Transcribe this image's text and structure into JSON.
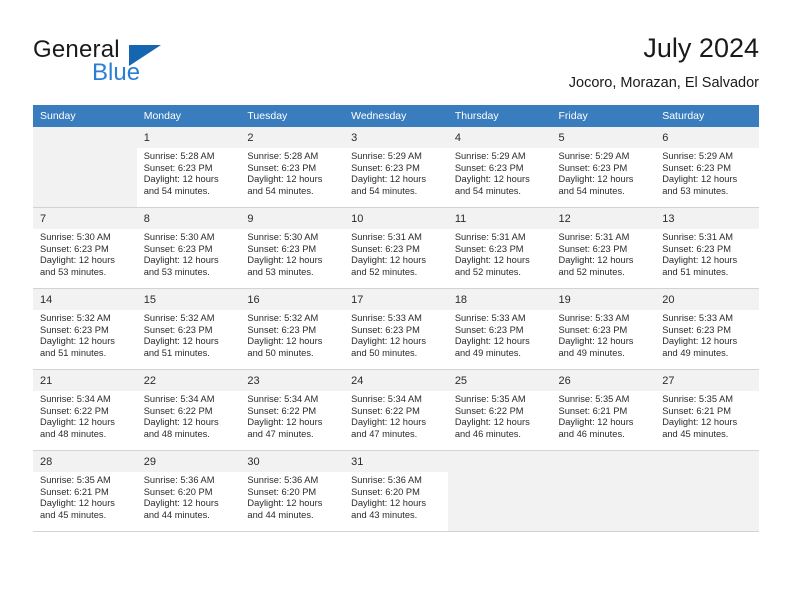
{
  "brand": {
    "word1": "General",
    "word2": "Blue",
    "triangle_icon": "triangle-icon",
    "accent_dark": "#1565b0",
    "accent_light": "#2a7fd4"
  },
  "header": {
    "title": "July 2024",
    "subtitle": "Jocoro, Morazan, El Salvador"
  },
  "calendar": {
    "header_bg": "#3a7dbf",
    "daynum_bg": "#f2f2f2",
    "weekdays": [
      "Sunday",
      "Monday",
      "Tuesday",
      "Wednesday",
      "Thursday",
      "Friday",
      "Saturday"
    ],
    "weeks": [
      [
        {
          "day": "",
          "sunrise": "",
          "sunset": "",
          "daylight1": "",
          "daylight2": "",
          "empty": true
        },
        {
          "day": "1",
          "sunrise": "Sunrise: 5:28 AM",
          "sunset": "Sunset: 6:23 PM",
          "daylight1": "Daylight: 12 hours",
          "daylight2": "and 54 minutes.",
          "empty": false
        },
        {
          "day": "2",
          "sunrise": "Sunrise: 5:28 AM",
          "sunset": "Sunset: 6:23 PM",
          "daylight1": "Daylight: 12 hours",
          "daylight2": "and 54 minutes.",
          "empty": false
        },
        {
          "day": "3",
          "sunrise": "Sunrise: 5:29 AM",
          "sunset": "Sunset: 6:23 PM",
          "daylight1": "Daylight: 12 hours",
          "daylight2": "and 54 minutes.",
          "empty": false
        },
        {
          "day": "4",
          "sunrise": "Sunrise: 5:29 AM",
          "sunset": "Sunset: 6:23 PM",
          "daylight1": "Daylight: 12 hours",
          "daylight2": "and 54 minutes.",
          "empty": false
        },
        {
          "day": "5",
          "sunrise": "Sunrise: 5:29 AM",
          "sunset": "Sunset: 6:23 PM",
          "daylight1": "Daylight: 12 hours",
          "daylight2": "and 54 minutes.",
          "empty": false
        },
        {
          "day": "6",
          "sunrise": "Sunrise: 5:29 AM",
          "sunset": "Sunset: 6:23 PM",
          "daylight1": "Daylight: 12 hours",
          "daylight2": "and 53 minutes.",
          "empty": false
        }
      ],
      [
        {
          "day": "7",
          "sunrise": "Sunrise: 5:30 AM",
          "sunset": "Sunset: 6:23 PM",
          "daylight1": "Daylight: 12 hours",
          "daylight2": "and 53 minutes.",
          "empty": false
        },
        {
          "day": "8",
          "sunrise": "Sunrise: 5:30 AM",
          "sunset": "Sunset: 6:23 PM",
          "daylight1": "Daylight: 12 hours",
          "daylight2": "and 53 minutes.",
          "empty": false
        },
        {
          "day": "9",
          "sunrise": "Sunrise: 5:30 AM",
          "sunset": "Sunset: 6:23 PM",
          "daylight1": "Daylight: 12 hours",
          "daylight2": "and 53 minutes.",
          "empty": false
        },
        {
          "day": "10",
          "sunrise": "Sunrise: 5:31 AM",
          "sunset": "Sunset: 6:23 PM",
          "daylight1": "Daylight: 12 hours",
          "daylight2": "and 52 minutes.",
          "empty": false
        },
        {
          "day": "11",
          "sunrise": "Sunrise: 5:31 AM",
          "sunset": "Sunset: 6:23 PM",
          "daylight1": "Daylight: 12 hours",
          "daylight2": "and 52 minutes.",
          "empty": false
        },
        {
          "day": "12",
          "sunrise": "Sunrise: 5:31 AM",
          "sunset": "Sunset: 6:23 PM",
          "daylight1": "Daylight: 12 hours",
          "daylight2": "and 52 minutes.",
          "empty": false
        },
        {
          "day": "13",
          "sunrise": "Sunrise: 5:31 AM",
          "sunset": "Sunset: 6:23 PM",
          "daylight1": "Daylight: 12 hours",
          "daylight2": "and 51 minutes.",
          "empty": false
        }
      ],
      [
        {
          "day": "14",
          "sunrise": "Sunrise: 5:32 AM",
          "sunset": "Sunset: 6:23 PM",
          "daylight1": "Daylight: 12 hours",
          "daylight2": "and 51 minutes.",
          "empty": false
        },
        {
          "day": "15",
          "sunrise": "Sunrise: 5:32 AM",
          "sunset": "Sunset: 6:23 PM",
          "daylight1": "Daylight: 12 hours",
          "daylight2": "and 51 minutes.",
          "empty": false
        },
        {
          "day": "16",
          "sunrise": "Sunrise: 5:32 AM",
          "sunset": "Sunset: 6:23 PM",
          "daylight1": "Daylight: 12 hours",
          "daylight2": "and 50 minutes.",
          "empty": false
        },
        {
          "day": "17",
          "sunrise": "Sunrise: 5:33 AM",
          "sunset": "Sunset: 6:23 PM",
          "daylight1": "Daylight: 12 hours",
          "daylight2": "and 50 minutes.",
          "empty": false
        },
        {
          "day": "18",
          "sunrise": "Sunrise: 5:33 AM",
          "sunset": "Sunset: 6:23 PM",
          "daylight1": "Daylight: 12 hours",
          "daylight2": "and 49 minutes.",
          "empty": false
        },
        {
          "day": "19",
          "sunrise": "Sunrise: 5:33 AM",
          "sunset": "Sunset: 6:23 PM",
          "daylight1": "Daylight: 12 hours",
          "daylight2": "and 49 minutes.",
          "empty": false
        },
        {
          "day": "20",
          "sunrise": "Sunrise: 5:33 AM",
          "sunset": "Sunset: 6:23 PM",
          "daylight1": "Daylight: 12 hours",
          "daylight2": "and 49 minutes.",
          "empty": false
        }
      ],
      [
        {
          "day": "21",
          "sunrise": "Sunrise: 5:34 AM",
          "sunset": "Sunset: 6:22 PM",
          "daylight1": "Daylight: 12 hours",
          "daylight2": "and 48 minutes.",
          "empty": false
        },
        {
          "day": "22",
          "sunrise": "Sunrise: 5:34 AM",
          "sunset": "Sunset: 6:22 PM",
          "daylight1": "Daylight: 12 hours",
          "daylight2": "and 48 minutes.",
          "empty": false
        },
        {
          "day": "23",
          "sunrise": "Sunrise: 5:34 AM",
          "sunset": "Sunset: 6:22 PM",
          "daylight1": "Daylight: 12 hours",
          "daylight2": "and 47 minutes.",
          "empty": false
        },
        {
          "day": "24",
          "sunrise": "Sunrise: 5:34 AM",
          "sunset": "Sunset: 6:22 PM",
          "daylight1": "Daylight: 12 hours",
          "daylight2": "and 47 minutes.",
          "empty": false
        },
        {
          "day": "25",
          "sunrise": "Sunrise: 5:35 AM",
          "sunset": "Sunset: 6:22 PM",
          "daylight1": "Daylight: 12 hours",
          "daylight2": "and 46 minutes.",
          "empty": false
        },
        {
          "day": "26",
          "sunrise": "Sunrise: 5:35 AM",
          "sunset": "Sunset: 6:21 PM",
          "daylight1": "Daylight: 12 hours",
          "daylight2": "and 46 minutes.",
          "empty": false
        },
        {
          "day": "27",
          "sunrise": "Sunrise: 5:35 AM",
          "sunset": "Sunset: 6:21 PM",
          "daylight1": "Daylight: 12 hours",
          "daylight2": "and 45 minutes.",
          "empty": false
        }
      ],
      [
        {
          "day": "28",
          "sunrise": "Sunrise: 5:35 AM",
          "sunset": "Sunset: 6:21 PM",
          "daylight1": "Daylight: 12 hours",
          "daylight2": "and 45 minutes.",
          "empty": false
        },
        {
          "day": "29",
          "sunrise": "Sunrise: 5:36 AM",
          "sunset": "Sunset: 6:20 PM",
          "daylight1": "Daylight: 12 hours",
          "daylight2": "and 44 minutes.",
          "empty": false
        },
        {
          "day": "30",
          "sunrise": "Sunrise: 5:36 AM",
          "sunset": "Sunset: 6:20 PM",
          "daylight1": "Daylight: 12 hours",
          "daylight2": "and 44 minutes.",
          "empty": false
        },
        {
          "day": "31",
          "sunrise": "Sunrise: 5:36 AM",
          "sunset": "Sunset: 6:20 PM",
          "daylight1": "Daylight: 12 hours",
          "daylight2": "and 43 minutes.",
          "empty": false
        },
        {
          "day": "",
          "sunrise": "",
          "sunset": "",
          "daylight1": "",
          "daylight2": "",
          "empty": true
        },
        {
          "day": "",
          "sunrise": "",
          "sunset": "",
          "daylight1": "",
          "daylight2": "",
          "empty": true
        },
        {
          "day": "",
          "sunrise": "",
          "sunset": "",
          "daylight1": "",
          "daylight2": "",
          "empty": true
        }
      ]
    ]
  }
}
